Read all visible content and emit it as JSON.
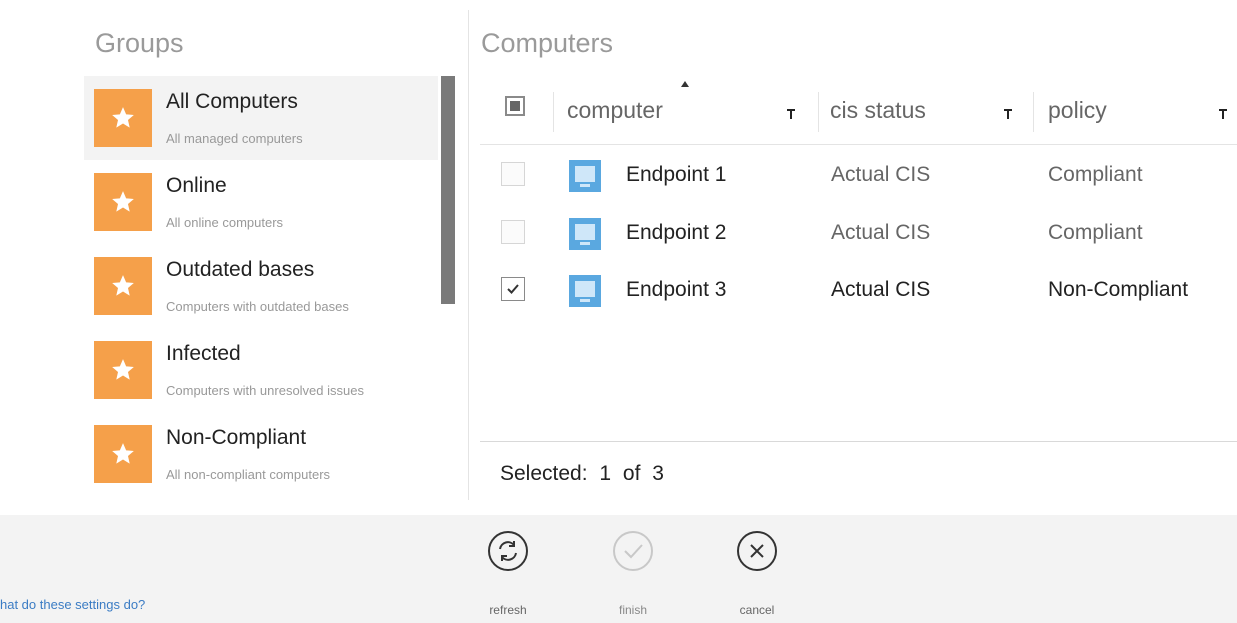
{
  "groups": {
    "title": "Groups",
    "items": [
      {
        "name": "All Computers",
        "desc": "All managed computers"
      },
      {
        "name": "Online",
        "desc": "All online computers"
      },
      {
        "name": "Outdated bases",
        "desc": "Computers with outdated bases"
      },
      {
        "name": "Infected",
        "desc": "Computers with unresolved issues"
      },
      {
        "name": "Non-Compliant",
        "desc": "All non-compliant computers"
      }
    ]
  },
  "computers": {
    "title": "Computers",
    "columns": [
      "computer",
      "cis status",
      "policy"
    ],
    "rows": [
      {
        "name": "Endpoint 1",
        "cis": "Actual CIS",
        "policy": "Compliant",
        "checked": false
      },
      {
        "name": "Endpoint 2",
        "cis": "Actual CIS",
        "policy": "Compliant",
        "checked": false
      },
      {
        "name": "Endpoint 3",
        "cis": "Actual CIS",
        "policy": "Non-Compliant",
        "checked": true
      }
    ],
    "selected_text": "Selected: 1 of 3"
  },
  "footer": {
    "help_link": "hat do these settings do?",
    "actions": [
      "refresh",
      "finish",
      "cancel"
    ]
  },
  "colors": {
    "group_tile": "#f5a04a",
    "computer_icon": "#5aa8e0",
    "link": "#3b7cc4"
  }
}
